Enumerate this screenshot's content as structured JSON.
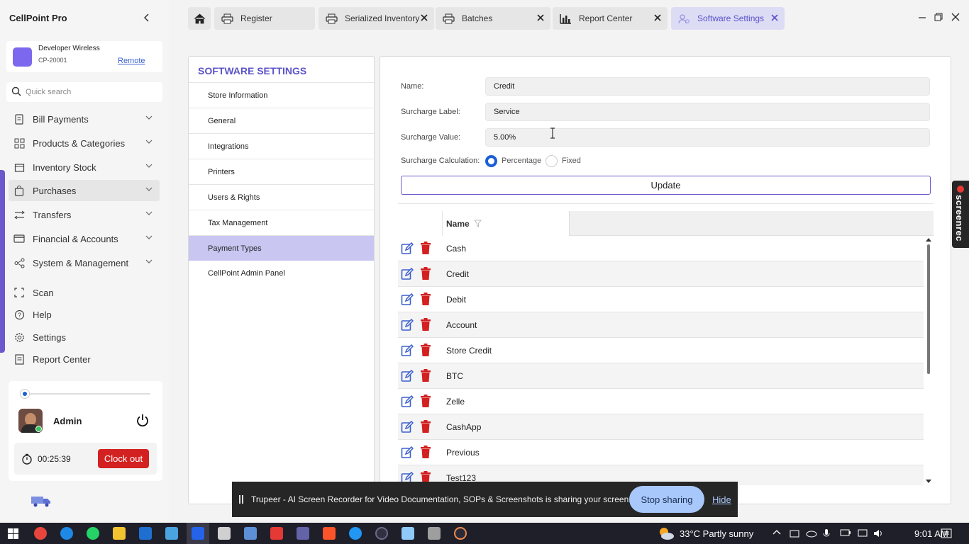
{
  "app": {
    "title": "CellPoint Pro"
  },
  "store": {
    "name": "Developer Wireless",
    "code": "CP-20001",
    "remote_label": "Remote"
  },
  "search": {
    "placeholder": "Quick search"
  },
  "nav": {
    "groups": [
      {
        "label": "Bill Payments",
        "icon": "receipt-icon"
      },
      {
        "label": "Products & Categories",
        "icon": "grid-icon"
      },
      {
        "label": "Inventory Stock",
        "icon": "box-icon"
      },
      {
        "label": "Purchases",
        "icon": "bag-icon",
        "selected": true
      },
      {
        "label": "Transfers",
        "icon": "transfer-icon"
      },
      {
        "label": "Financial & Accounts",
        "icon": "card-icon"
      },
      {
        "label": "System & Management",
        "icon": "nodes-icon"
      }
    ],
    "links": [
      {
        "label": "Scan",
        "icon": "scan-icon"
      },
      {
        "label": "Help",
        "icon": "help-icon"
      },
      {
        "label": "Settings",
        "icon": "gear-icon"
      },
      {
        "label": "Report Center",
        "icon": "report-icon"
      }
    ]
  },
  "user": {
    "name": "Admin",
    "timer": "00:25:39",
    "clock_out_label": "Clock out"
  },
  "tabs": [
    {
      "label": "Register",
      "icon": "printer-icon",
      "closable": false
    },
    {
      "label": "Serialized Inventory",
      "icon": "printer-icon",
      "closable": true
    },
    {
      "label": "Batches",
      "icon": "printer-icon",
      "closable": true
    },
    {
      "label": "Report Center",
      "icon": "bar-chart-icon",
      "closable": true
    },
    {
      "label": "Software Settings",
      "icon": "settings-icon",
      "closable": true,
      "active": true
    }
  ],
  "settings": {
    "title": "SOFTWARE SETTINGS",
    "menu": [
      "Store Information",
      "General",
      "Integrations",
      "Printers",
      "Users & Rights",
      "Tax Management",
      "Payment Types",
      "CellPoint Admin Panel"
    ],
    "active_menu": "Payment Types"
  },
  "form": {
    "name_label": "Name:",
    "name_value": "Credit",
    "surcharge_label_label": "Surcharge Label:",
    "surcharge_label_value": "Service",
    "surcharge_value_label": "Surcharge Value:",
    "surcharge_value_value": "5.00%",
    "calc_label": "Surcharge Calculation:",
    "calc_options": [
      "Percentage",
      "Fixed"
    ],
    "calc_selected": "Percentage",
    "update_label": "Update"
  },
  "grid": {
    "column_name": "Name",
    "rows": [
      "Cash",
      "Credit",
      "Debit",
      "Account",
      "Store Credit",
      "BTC",
      "Zelle",
      "CashApp",
      "Previous",
      "Test123"
    ]
  },
  "overlay": {
    "screenrec_label": "screenrec",
    "share_text": "Trupeer - AI Screen Recorder for Video Documentation, SOPs & Screenshots is sharing your screen.",
    "stop_label": "Stop sharing",
    "hide_label": "Hide"
  },
  "taskbar": {
    "weather": "33°C  Partly sunny",
    "time": "9:01 AM"
  },
  "colors": {
    "accent": "#6a5acd",
    "title_purple": "#5b54c9",
    "danger": "#d32020",
    "edit_blue": "#3a5fcd",
    "radio_blue": "#1a5fd6"
  }
}
